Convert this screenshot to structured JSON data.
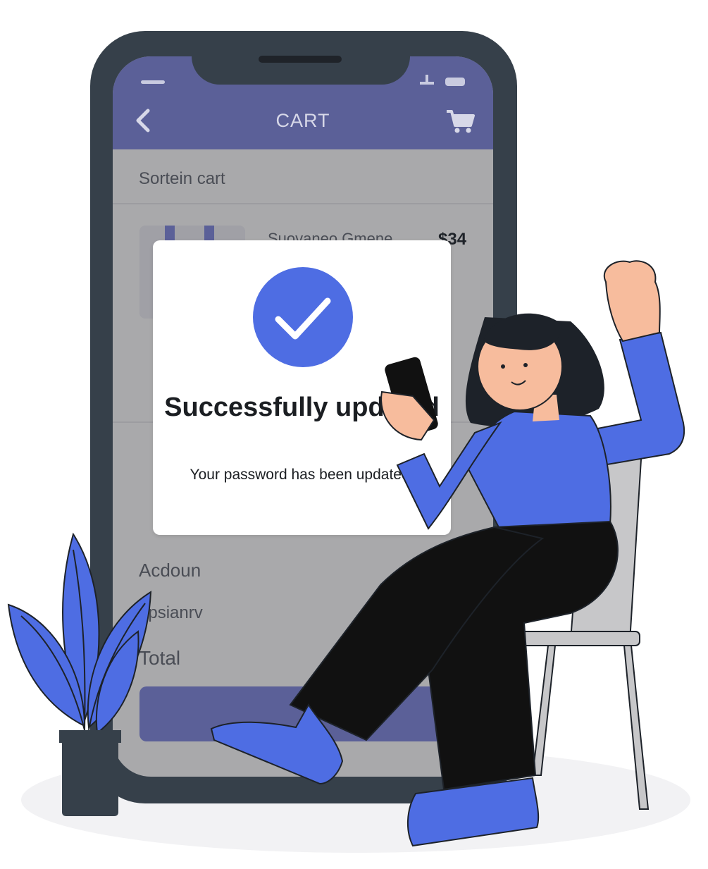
{
  "colors": {
    "accent": "#4e6de3",
    "app_bar": "#5b6098",
    "phone_frame": "#36404a",
    "pants": "#111111",
    "chair": "#c7c7c9",
    "skin": "#f7bc9d",
    "hair": "#1d2229"
  },
  "app": {
    "title": "CART",
    "section_label": "Sortein cart",
    "item": {
      "name": "Suovaneo Gmene",
      "price": "$34"
    },
    "summary": {
      "account_label": "Acdoun",
      "shipping_label": "upsianrv",
      "total_label": "Total"
    }
  },
  "dialog": {
    "title": "Successfully updated",
    "message": "Your password has been updated.",
    "icon": "check-circle-icon"
  },
  "icons": {
    "back": "chevron-left-icon",
    "cart": "cart-icon"
  }
}
